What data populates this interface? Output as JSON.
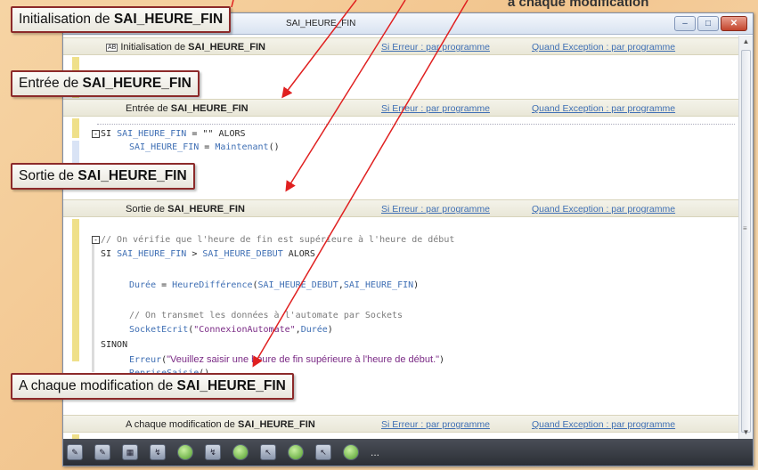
{
  "top_caption": "à chaque modification",
  "window": {
    "title": "SAI_HEURE_FIN",
    "buttons": {
      "minimize": "–",
      "maximize": "□",
      "close": "✕"
    }
  },
  "common": {
    "error_link": "Si Erreur : par programme",
    "exception_link": "Quand Exception : par programme"
  },
  "sections": [
    {
      "prefix": "Initialisation de ",
      "name": "SAI_HEURE_FIN"
    },
    {
      "prefix": "Entrée de ",
      "name": "SAI_HEURE_FIN"
    },
    {
      "prefix": "Sortie de ",
      "name": "SAI_HEURE_FIN"
    },
    {
      "prefix": "A chaque modification de ",
      "name": "SAI_HEURE_FIN"
    }
  ],
  "code_entree": {
    "l1_kw": "SI ",
    "l1_var": "SAI_HEURE_FIN",
    "l1_rest": " = \"\" ALORS",
    "l2_var1": "SAI_HEURE_FIN",
    "l2_eq": " = ",
    "l2_fn": "Maintenant",
    "l2_par": "()"
  },
  "code_sortie": {
    "comment1": "// On vérifie que l'heure de fin est supérieure à l'heure de début",
    "if_kw": "SI ",
    "if_var1": "SAI_HEURE_FIN",
    "if_gt": " > ",
    "if_var2": "SAI_HEURE_DEBUT",
    "if_alors": " ALORS",
    "duree_var": "Durée",
    "duree_eq": " = ",
    "duree_fn": "HeureDifférence",
    "duree_args_open": "(",
    "duree_arg1": "SAI_HEURE_DEBUT",
    "duree_comma": ",",
    "duree_arg2": "SAI_HEURE_FIN",
    "duree_close": ")",
    "comment2": "// On transmet les données à l'automate par Sockets",
    "socket_fn": "SocketEcrit",
    "socket_open": "(",
    "socket_str": "\"ConnexionAutomate\"",
    "socket_comma": ",",
    "socket_arg": "Durée",
    "socket_close": ")",
    "sinon": "SINON",
    "erreur_fn": "Erreur",
    "erreur_open": "(",
    "erreur_str": "\"Veuillez saisir une heure de fin supérieure à l'heure de début.\"",
    "erreur_close": ")",
    "reprise_fn": "RepriseSaisie",
    "reprise_par": "()"
  },
  "callouts": [
    {
      "prefix": "Initialisation de ",
      "name": "SAI_HEURE_FIN"
    },
    {
      "prefix": "Entrée de ",
      "name": "SAI_HEURE_FIN"
    },
    {
      "prefix": "Sortie de ",
      "name": "SAI_HEURE_FIN"
    },
    {
      "prefix": "A chaque modification de ",
      "name": "SAI_HEURE_FIN"
    }
  ],
  "toolbar": {
    "icons": [
      "code-view-icon",
      "code-edit-icon",
      "window-icon",
      "event-icon",
      "green-event-icon",
      "event-2-icon",
      "green-event-2-icon",
      "cursor-event-icon",
      "green-cursor-icon",
      "cursor-event-2-icon",
      "green-event-3-icon"
    ],
    "more": "..."
  },
  "colors": {
    "callout_border": "#8c2a2a",
    "arrow": "#e02020",
    "link": "#3f6fb4",
    "string": "#7a2a85"
  }
}
